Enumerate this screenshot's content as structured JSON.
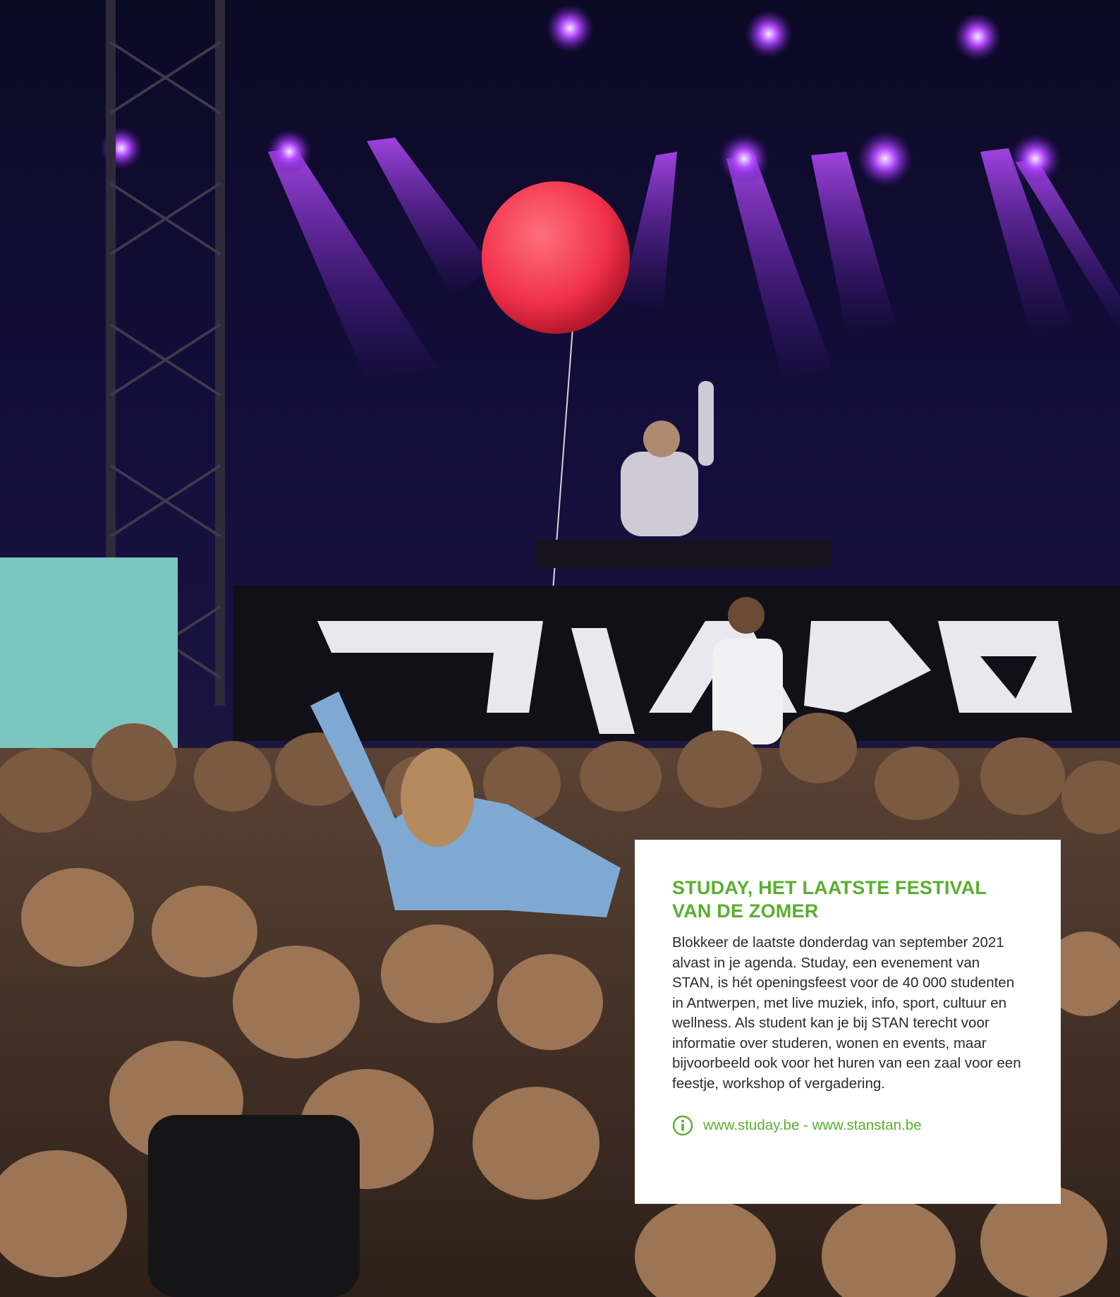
{
  "card": {
    "title": "STUDAY, HET LAATSTE FESTIVAL VAN DE ZOMER",
    "body": "Blokkeer de laatste donderdag van september 2021 alvast in je agenda. Studay, een evenement van STAN, is hét openingsfeest voor de 40 000 studenten in Antwerpen, met live muziek, info, sport, cultuur en wellness. Als student kan je bij STAN terecht voor informatie over studeren, wonen en events, maar bijvoorbeeld ook voor het huren van een zaal voor een feestje, workshop of vergadering.",
    "link_text": "www.studay.be - www.stanstan.be",
    "link_icon": "info-icon"
  },
  "colors": {
    "accent": "#5aae31",
    "body_text": "#2b2b2b",
    "card_background": "#ffffff"
  },
  "photo": {
    "subject": "festival-crowd-photo"
  }
}
